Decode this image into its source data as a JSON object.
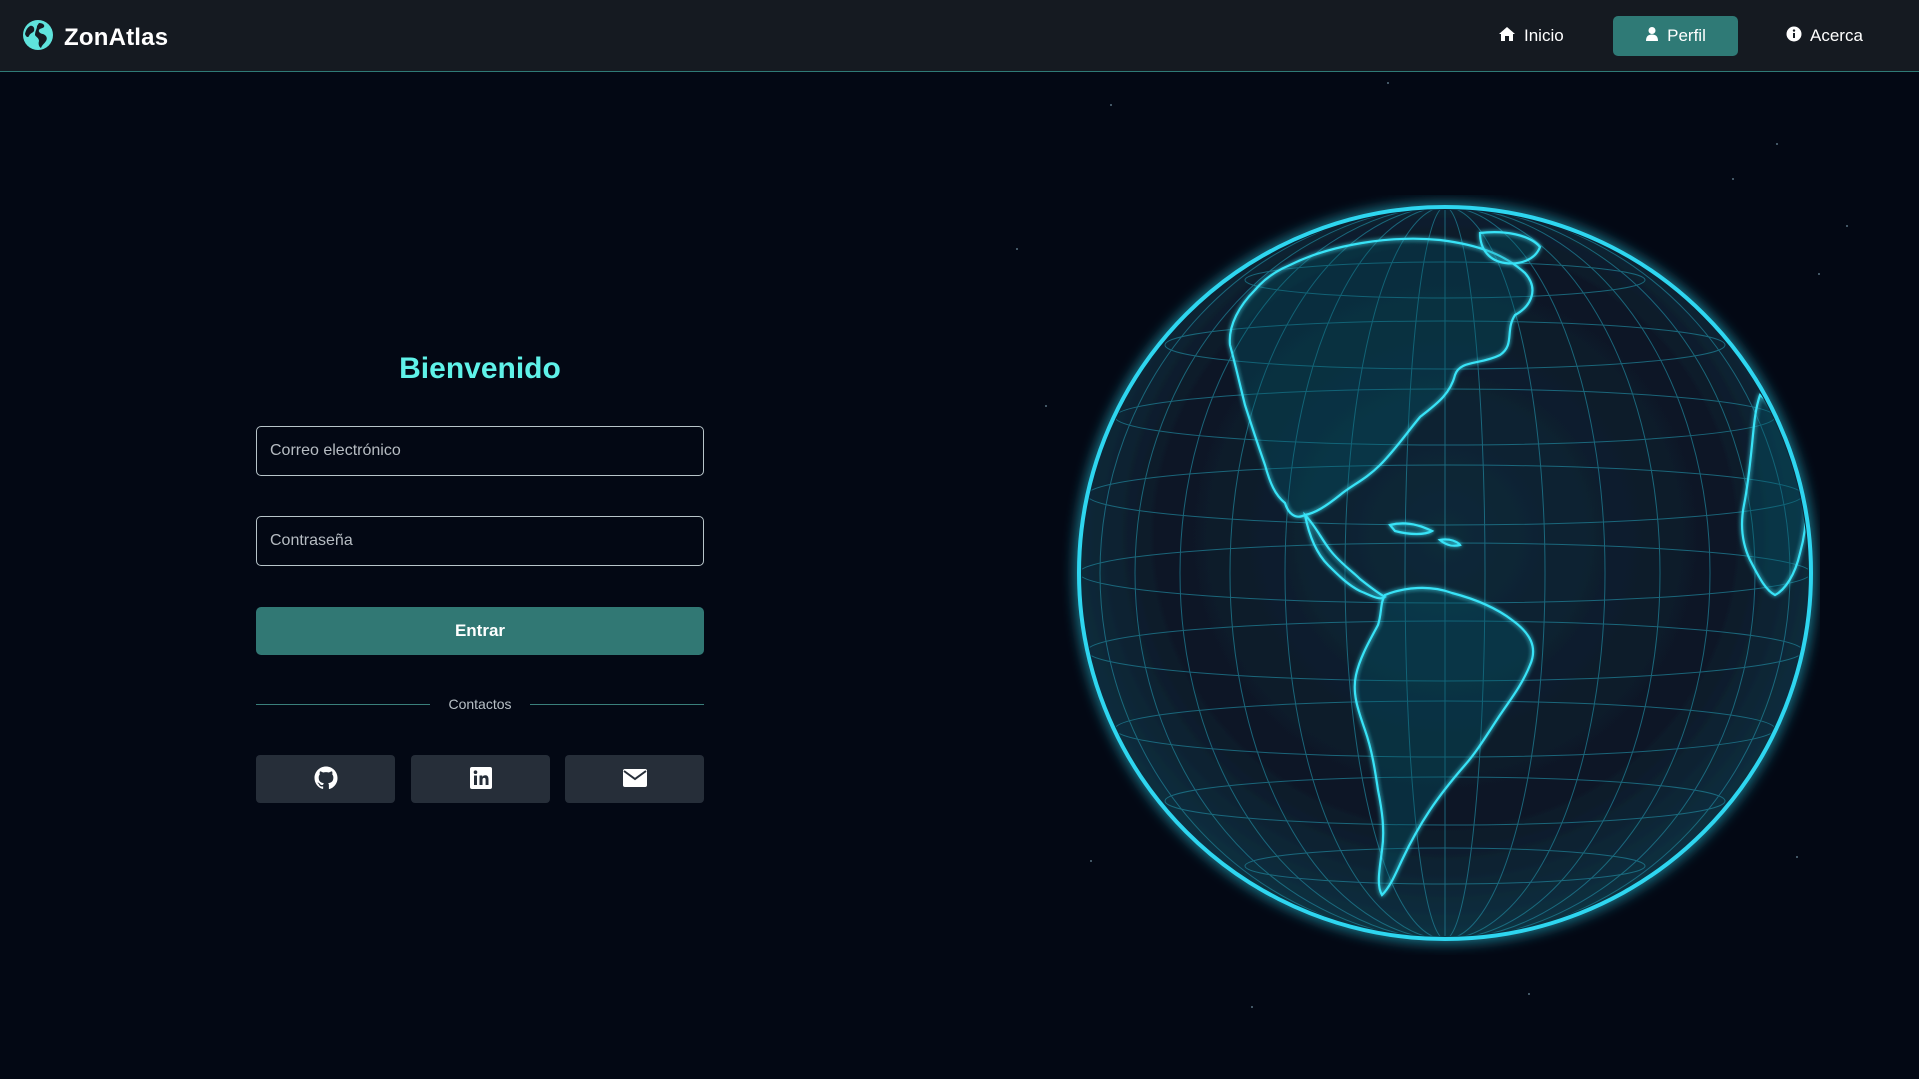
{
  "app": {
    "name": "ZonAtlas",
    "logo_icon": "globe-icon"
  },
  "nav": {
    "items": [
      {
        "label": "Inicio",
        "icon": "home-icon",
        "active": false
      },
      {
        "label": "Perfil",
        "icon": "user-icon",
        "active": true
      },
      {
        "label": "Acerca",
        "icon": "info-icon",
        "active": false
      }
    ]
  },
  "login": {
    "title": "Bienvenido",
    "email_placeholder": "Correo electrónico",
    "password_placeholder": "Contraseña",
    "submit_label": "Entrar",
    "divider_label": "Contactos",
    "social": [
      {
        "icon": "github-icon"
      },
      {
        "icon": "linkedin-icon"
      },
      {
        "icon": "email-icon"
      }
    ]
  },
  "colors": {
    "background": "#030814",
    "navbar": "#151a21",
    "accent": "#2f7a76",
    "title": "#5ff2e9",
    "globe_glow": "#22c9e6"
  }
}
